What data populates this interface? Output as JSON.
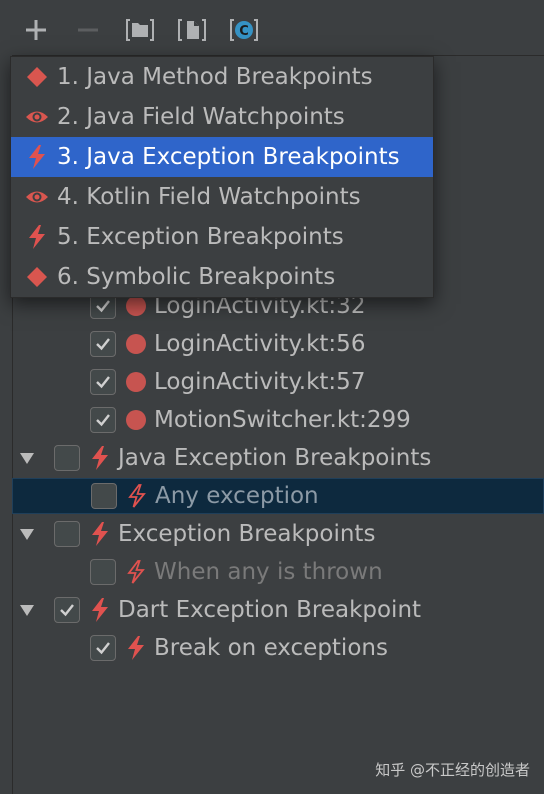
{
  "toolbar": {
    "add": "add-icon",
    "remove": "remove-icon",
    "group_folder": "folder-icon",
    "group_file": "file-icon",
    "group_class": "class-icon"
  },
  "colors": {
    "breakpoint_red": "#c75450",
    "lightning_red": "#e0524f",
    "highlight_blue": "#2f65ca",
    "selected_row": "#0d293e",
    "class_badge": "#3592c4"
  },
  "menu": {
    "items": [
      {
        "label": "1. Java Method Breakpoints",
        "icon": "diamond-icon"
      },
      {
        "label": "2. Java Field Watchpoints",
        "icon": "eye-icon"
      },
      {
        "label": "3. Java Exception Breakpoints",
        "icon": "lightning-icon",
        "highlighted": true
      },
      {
        "label": "4. Kotlin Field Watchpoints",
        "icon": "eye-icon"
      },
      {
        "label": "5. Exception Breakpoints",
        "icon": "lightning-icon"
      },
      {
        "label": "6. Symbolic Breakpoints",
        "icon": "diamond-icon"
      }
    ]
  },
  "tree": {
    "line_breakpoints": [
      {
        "label": "LoginActivity.kt:32",
        "checked": true
      },
      {
        "label": "LoginActivity.kt:56",
        "checked": true
      },
      {
        "label": "LoginActivity.kt:57",
        "checked": true
      },
      {
        "label": "MotionSwitcher.kt:299",
        "checked": true
      }
    ],
    "java_exception_group": {
      "label": "Java Exception Breakpoints",
      "checked": false
    },
    "java_any_exception": {
      "label": "Any exception",
      "checked": false
    },
    "exception_group": {
      "label": "Exception Breakpoints",
      "checked": false
    },
    "exception_when_thrown": {
      "label": "When any is thrown",
      "checked": false
    },
    "dart_group": {
      "label": "Dart Exception Breakpoint",
      "checked": true
    },
    "dart_break": {
      "label": "Break on exceptions",
      "checked": true
    }
  },
  "watermark": "知乎 @不正经的创造者"
}
